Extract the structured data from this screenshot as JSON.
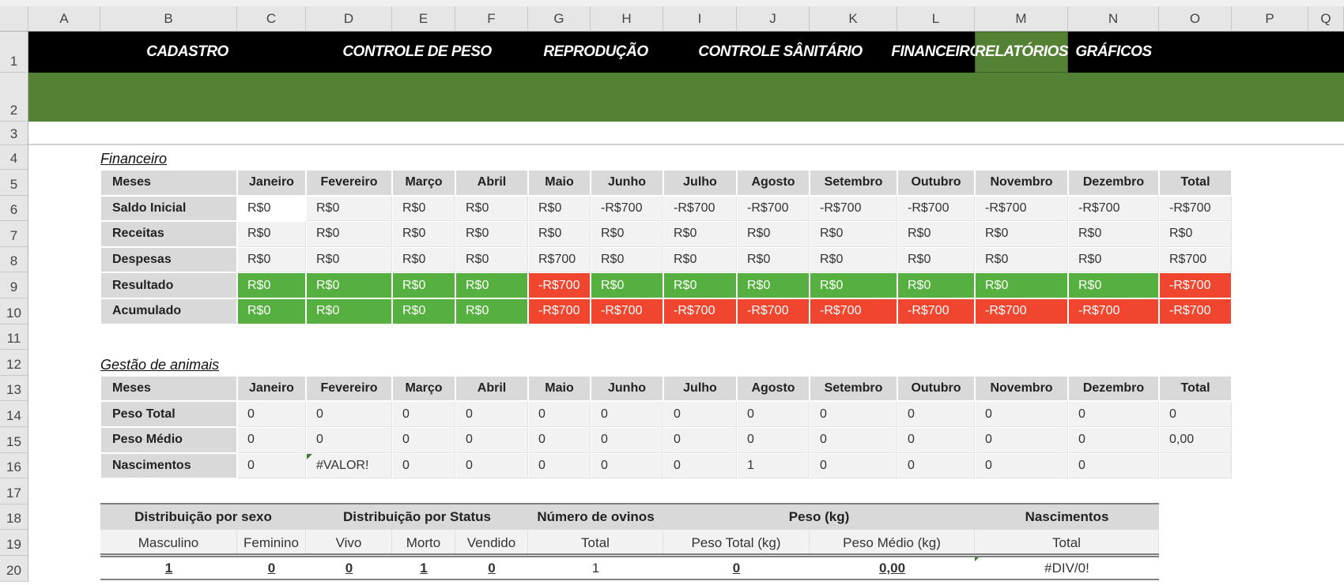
{
  "columns": [
    "A",
    "B",
    "C",
    "D",
    "E",
    "F",
    "G",
    "H",
    "I",
    "J",
    "K",
    "L",
    "M",
    "N",
    "O",
    "P",
    "Q"
  ],
  "rows": [
    "1",
    "2",
    "3",
    "4",
    "5",
    "6",
    "7",
    "8",
    "9",
    "10",
    "11",
    "12",
    "13",
    "14",
    "15",
    "16",
    "17",
    "18",
    "19",
    "20"
  ],
  "nav": {
    "items": [
      "CADASTRO",
      "CONTROLE DE PESO",
      "REPRODUÇÃO",
      "CONTROLE SÂNITÁRIO",
      "FINANCEIRO",
      "RELATÓRIOS",
      "GRÁFICOS"
    ],
    "active": "RELATÓRIOS"
  },
  "colors": {
    "banner": "#548235",
    "positive": "#55b03f",
    "negative": "#f0452f",
    "header": "#d9d9d9"
  },
  "financeiro": {
    "title": "Financeiro",
    "header": [
      "Meses",
      "Janeiro",
      "Fevereiro",
      "Março",
      "Abril",
      "Maio",
      "Junho",
      "Julho",
      "Agosto",
      "Setembro",
      "Outubro",
      "Novembro",
      "Dezembro",
      "Total"
    ],
    "rows": [
      {
        "label": "Saldo Inicial",
        "values": [
          "R$0",
          "R$0",
          "R$0",
          "R$0",
          "R$0",
          "-R$700",
          "-R$700",
          "-R$700",
          "-R$700",
          "-R$700",
          "-R$700",
          "-R$700",
          "-R$700"
        ]
      },
      {
        "label": "Receitas",
        "values": [
          "R$0",
          "R$0",
          "R$0",
          "R$0",
          "R$0",
          "R$0",
          "R$0",
          "R$0",
          "R$0",
          "R$0",
          "R$0",
          "R$0",
          "R$0"
        ]
      },
      {
        "label": "Despesas",
        "values": [
          "R$0",
          "R$0",
          "R$0",
          "R$0",
          "R$700",
          "R$0",
          "R$0",
          "R$0",
          "R$0",
          "R$0",
          "R$0",
          "R$0",
          "R$700"
        ]
      },
      {
        "label": "Resultado",
        "values": [
          "R$0",
          "R$0",
          "R$0",
          "R$0",
          "-R$700",
          "R$0",
          "R$0",
          "R$0",
          "R$0",
          "R$0",
          "R$0",
          "R$0",
          "-R$700"
        ],
        "colored": true
      },
      {
        "label": "Acumulado",
        "values": [
          "R$0",
          "R$0",
          "R$0",
          "R$0",
          "-R$700",
          "-R$700",
          "-R$700",
          "-R$700",
          "-R$700",
          "-R$700",
          "-R$700",
          "-R$700",
          "-R$700"
        ],
        "colored": true
      }
    ]
  },
  "gestao": {
    "title": "Gestão de animais",
    "header": [
      "Meses",
      "Janeiro",
      "Fevereiro",
      "Março",
      "Abril",
      "Maio",
      "Junho",
      "Julho",
      "Agosto",
      "Setembro",
      "Outubro",
      "Novembro",
      "Dezembro",
      "Total"
    ],
    "rows": [
      {
        "label": "Peso Total",
        "values": [
          "0",
          "0",
          "0",
          "0",
          "0",
          "0",
          "0",
          "0",
          "0",
          "0",
          "0",
          "0",
          "0"
        ]
      },
      {
        "label": "Peso Médio",
        "values": [
          "0",
          "0",
          "0",
          "0",
          "0",
          "0",
          "0",
          "0",
          "0",
          "0",
          "0",
          "0",
          "0,00"
        ]
      },
      {
        "label": "Nascimentos",
        "values": [
          "0",
          "#VALOR!",
          "0",
          "0",
          "0",
          "0",
          "0",
          "1",
          "0",
          "0",
          "0",
          "0",
          ""
        ]
      }
    ]
  },
  "summary": {
    "groups": [
      "Distribuição por sexo",
      "Distribuição por Status",
      "Número de ovinos",
      "Peso (kg)",
      "Nascimentos"
    ],
    "subheaders": [
      "Masculino",
      "Feminino",
      "Vivo",
      "Morto",
      "Vendido",
      "Total",
      "Peso Total (kg)",
      "Peso Médio (kg)",
      "Total"
    ],
    "values": [
      "1",
      "0",
      "0",
      "1",
      "0",
      "1",
      "0",
      "0,00",
      "#DIV/0!"
    ]
  }
}
